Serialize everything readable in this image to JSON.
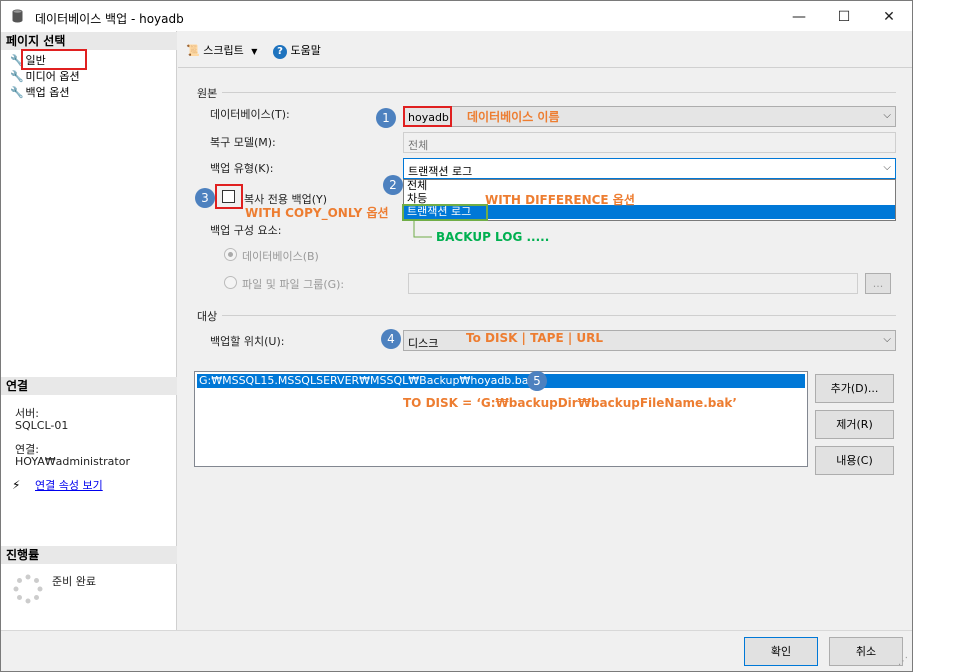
{
  "window": {
    "title": "데이터베이스 백업 - hoyadb",
    "minimize": "—",
    "maximize": "☐",
    "close": "✕"
  },
  "sidebar": {
    "page_select_header": "페이지 선택",
    "items": [
      {
        "label": "일반"
      },
      {
        "label": "미디어 옵션"
      },
      {
        "label": "백업 옵션"
      }
    ],
    "connection_header": "연결",
    "server_label": "서버:",
    "server_value": "SQLCL-01",
    "conn_label": "연결:",
    "conn_value": "HOYA₩administrator",
    "conn_link": "연결 속성 보기",
    "progress_header": "진행률",
    "progress_status": "준비 완료"
  },
  "toolbar": {
    "script_label": "스크립트",
    "help_label": "도움말"
  },
  "source": {
    "group": "원본",
    "database_label": "데이터베이스(T):",
    "database_value": "hoyadb",
    "recovery_label": "복구 모델(M):",
    "recovery_value": "전체",
    "backup_type_label": "백업 유형(K):",
    "backup_type_value": "트랜잭션 로그",
    "backup_type_options": [
      "전체",
      "차등",
      "트랜잭션 로그"
    ],
    "copy_only_label": "복사 전용 백업(Y)",
    "component_label": "백업 구성 요소:",
    "radio_database": "데이터베이스(B)",
    "radio_files": "파일 및 파일 그룹(G):",
    "browse_label": "..."
  },
  "destination": {
    "group": "대상",
    "backup_to_label": "백업할 위치(U):",
    "backup_to_value": "디스크",
    "paths": [
      "G:₩MSSQL15.MSSQLSERVER₩MSSQL₩Backup₩hoyadb.bak"
    ],
    "add_button": "추가(D)...",
    "remove_button": "제거(R)",
    "contents_button": "내용(C)"
  },
  "footer": {
    "ok_button": "확인",
    "cancel_button": "취소"
  },
  "annotations": {
    "n1": "1",
    "n2": "2",
    "n3": "3",
    "n4": "4",
    "n5": "5",
    "db_name": "데이터베이스  이름",
    "with_difference": "WITH  DIFFERENCE  옵션",
    "with_copy_only": "WITH  COPY_ONLY  옵션",
    "backup_log": "BACKUP  LOG  .....",
    "to_disk_options": "To  DISK  |  TAPE  |  URL",
    "to_disk_syntax": "TO DISK = ‘G:₩backupDir₩backupFileName.bak’"
  }
}
